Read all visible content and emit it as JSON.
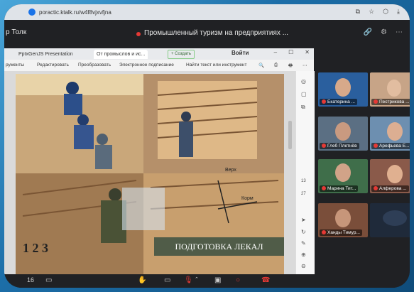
{
  "browser": {
    "url": "poractic.ktalk.ru/w4f8vjxvfjna",
    "icons": [
      "translate-icon",
      "star-icon",
      "extensions-icon",
      "download-icon"
    ]
  },
  "meeting": {
    "brand": "р Толк",
    "title": "Промышленный туризм на предприятиях ..."
  },
  "doc_window": {
    "tab1": "PptxGenJS Presentation",
    "tab2": "От промыслов и ис...",
    "new_tab": "+ Создать",
    "login": "Войти",
    "toolbar": [
      "рументы",
      "Редактировать",
      "Преобразовать",
      "Электронное подписание",
      "Найти текст или инструмент"
    ],
    "page_num": "13",
    "page_total": "27",
    "slide_caption": "ПОДГОТОВКА ЛЕКАЛ",
    "slide_digits": "1 2 3",
    "slide_label_top": "Верх",
    "slide_label_bottom": "Корм"
  },
  "participants": [
    {
      "name": "Екатерина ..."
    },
    {
      "name": "Пестрикова ..."
    },
    {
      "name": "Глеб Плетнёв"
    },
    {
      "name": "Арефьева Е..."
    },
    {
      "name": "Марина Тит..."
    },
    {
      "name": "Алферова ..."
    },
    {
      "name": "Ханды Тимур..."
    },
    {
      "name": ""
    }
  ],
  "bottom": {
    "count": "16"
  },
  "colors": {
    "mic_off": "#e53935",
    "accent": "#1a73e8"
  }
}
